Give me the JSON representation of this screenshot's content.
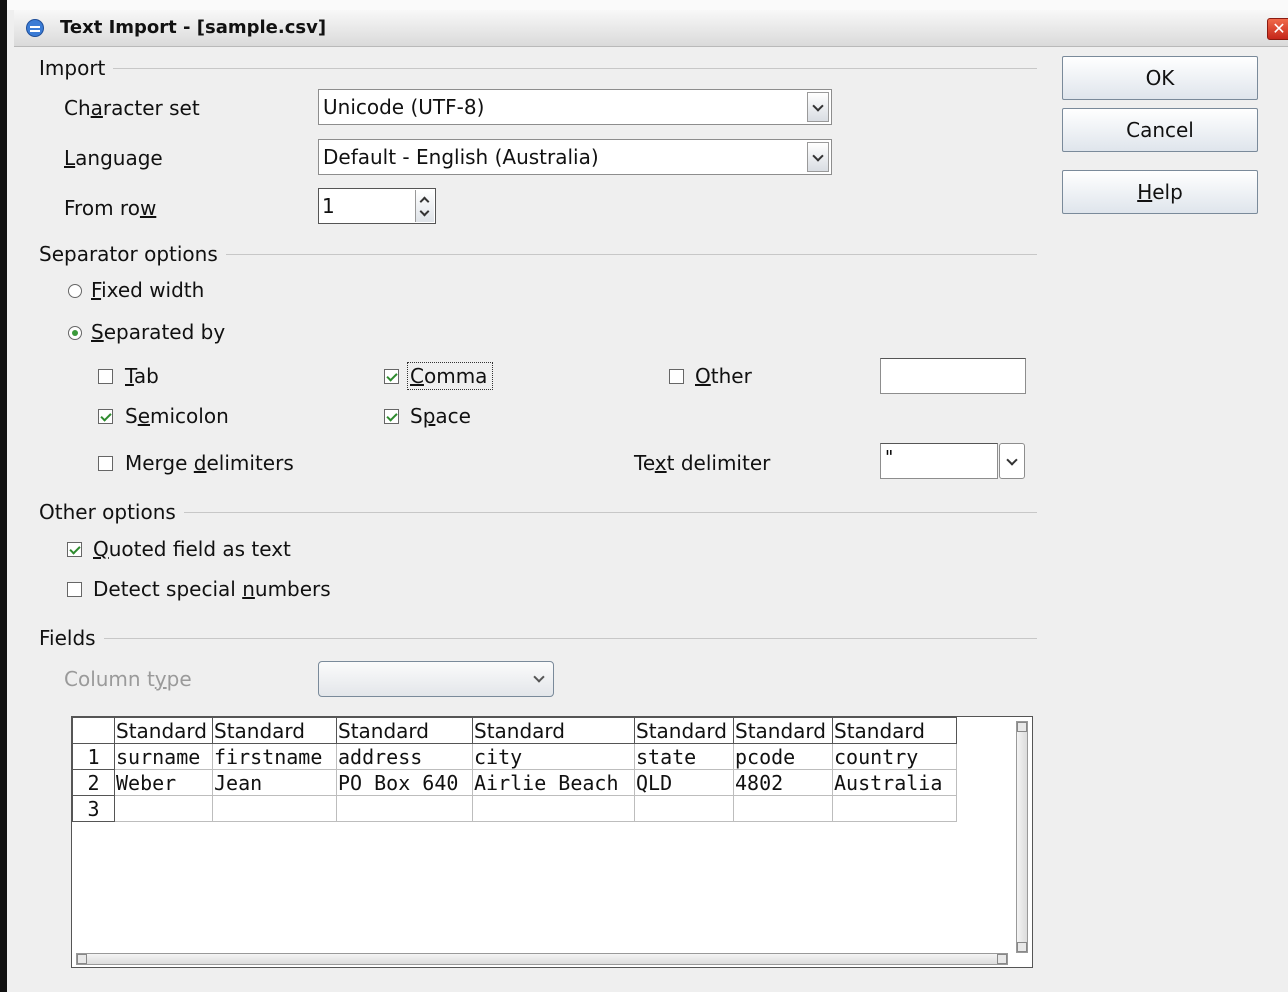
{
  "window": {
    "title": "Text Import - [sample.csv]",
    "close_glyph": "✕"
  },
  "buttons": {
    "ok": "OK",
    "cancel": "Cancel",
    "help": "Help"
  },
  "import": {
    "section": "Import",
    "charset_label": "Character set",
    "charset_value": "Unicode (UTF-8)",
    "language_label": "Language",
    "language_value": "Default - English (Australia)",
    "from_row_label": "From row",
    "from_row_value": "1"
  },
  "separator": {
    "section": "Separator options",
    "fixed_width": {
      "label": "Fixed width",
      "selected": false
    },
    "separated_by": {
      "label": "Separated by",
      "selected": true
    },
    "tab": {
      "label": "Tab",
      "checked": false
    },
    "comma": {
      "label": "Comma",
      "checked": true
    },
    "other": {
      "label": "Other",
      "checked": false,
      "value": ""
    },
    "semicolon": {
      "label": "Semicolon",
      "checked": true
    },
    "space": {
      "label": "Space",
      "checked": true
    },
    "merge": {
      "label": "Merge delimiters",
      "checked": false
    },
    "text_delimiter_label": "Text delimiter",
    "text_delimiter_value": "\""
  },
  "other_options": {
    "section": "Other options",
    "quoted": {
      "label": "Quoted field as text",
      "checked": true
    },
    "detect": {
      "label": "Detect special numbers",
      "checked": false
    }
  },
  "fields": {
    "section": "Fields",
    "column_type_label": "Column type",
    "column_type_value": "",
    "headers": [
      "Standard",
      "Standard",
      "Standard",
      "Standard",
      "Standard",
      "Standard",
      "Standard"
    ],
    "rows": [
      {
        "num": "1",
        "cells": [
          "surname",
          "firstname",
          "address",
          "city",
          "state",
          "pcode",
          "country"
        ]
      },
      {
        "num": "2",
        "cells": [
          "Weber",
          "Jean",
          "PO Box 640",
          "Airlie Beach",
          "QLD",
          "4802",
          "Australia"
        ]
      },
      {
        "num": "3",
        "cells": [
          "",
          "",
          "",
          "",
          "",
          "",
          ""
        ]
      }
    ]
  },
  "colors": {
    "dialog_bg": "#efefef",
    "radio_dot": "#3a9a3a",
    "check_mark": "#2e8b2e",
    "close_button": "#d9381e"
  }
}
